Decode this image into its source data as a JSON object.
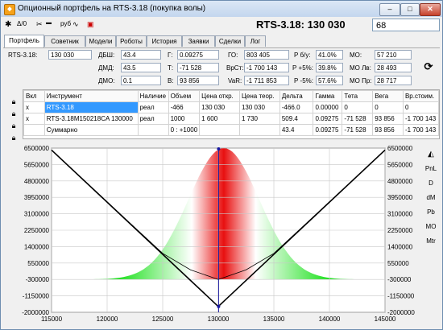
{
  "window": {
    "title": "Опционный портфель на RTS-3.18 (покупка волы)",
    "buttons": [
      "–",
      "□",
      "✕"
    ]
  },
  "toolbar": {
    "items": [
      "Δ/0",
      "руб"
    ],
    "heading": "RTS-3.18: 130 030",
    "right_value": "68"
  },
  "tabs": [
    "Портфель",
    "Советник",
    "Модели",
    "Роботы",
    "История",
    "Заявки",
    "Сделки",
    "Лог"
  ],
  "params": {
    "rts_label": "RTS-3.18:",
    "rts_value": "130 030",
    "dbsh_label": "ДБШ:",
    "dbsh_value": "43.4",
    "dmd_label": "ДМД:",
    "dmd_value": "43.5",
    "dmo_label": "ДМО:",
    "dmo_value": "0.1",
    "g_label": "Г:",
    "g_value": "0.09275",
    "t_label": "Т:",
    "t_value": "-71 528",
    "v_label": "В:",
    "v_value": "93 856",
    "go_label": "ГО:",
    "go_value": "803 405",
    "vrst_label": "ВрСт:",
    "vrst_value": "-1 700 143",
    "var_label": "VaR:",
    "var_value": "-1 711 853",
    "rbu_label": "Р б/у:",
    "rbu_value": "41.0%",
    "rp5_label": "Р +5%:",
    "rp5_value": "39.8%",
    "rm5_label": "Р -5%:",
    "rm5_value": "57.6%",
    "mo_label": "МО:",
    "mo_value": "57 210",
    "molv_label": "МО Лв:",
    "molv_value": "28 493",
    "mopr_label": "МО Пр:",
    "mopr_value": "28 717"
  },
  "table": {
    "headers": [
      "Вкл",
      "Инструмент",
      "Наличие",
      "Объем",
      "Цена откр.",
      "Цена теор.",
      "Дельта",
      "Гамма",
      "Тета",
      "Вега",
      "Вр.стоим."
    ],
    "rows": [
      [
        "x",
        "RTS-3.18",
        "реал",
        "-466",
        "130 030",
        "130 030",
        "-466.0",
        "0.00000",
        "0",
        "0",
        "0"
      ],
      [
        "x",
        "RTS-3.18M150218CA 130000",
        "реал",
        "1000",
        "1 600",
        "1 730",
        "509.4",
        "0.09275",
        "-71 528",
        "93 856",
        "-1 700 143"
      ],
      [
        "",
        "Суммарно",
        "",
        "0 : +1000",
        "",
        "",
        "43.4",
        "0.09275",
        "-71 528",
        "93 856",
        "-1 700 143"
      ]
    ]
  },
  "left_icons": [
    "lock-icon",
    "lock-icon",
    "lock-icon",
    "lock-icon"
  ],
  "side_left_tools": [
    "cursor-icon",
    "zoom-vertical-icon",
    "zoom-vertical-icon",
    "zoom-horizontal-icon",
    "zoom-horizontal-icon",
    "magnifier-icon",
    "move-icon",
    "list-icon"
  ],
  "side_left_log": "leg",
  "side_right_buttons": [
    "PnL",
    "D",
    "dM",
    "Pb",
    "MO",
    "Mtr"
  ],
  "colors": {
    "accent": "#3399ff",
    "density_red": "#e81010",
    "density_green": "#18e018",
    "grid": "#c8c8c8"
  },
  "chart_data": {
    "type": "line",
    "x_ticks": [
      "115000",
      "120000",
      "125000",
      "130000",
      "135000",
      "140000",
      "145000"
    ],
    "y_ticks": [
      "6500000",
      "5650000",
      "4800000",
      "3950000",
      "3100000",
      "2250000",
      "1400000",
      "550000",
      "-300000",
      "-1150000",
      "-2000000"
    ],
    "xlim": [
      115000,
      145000
    ],
    "ylim": [
      -2000000,
      6500000
    ],
    "current_price": 130030,
    "series": [
      {
        "values": [
          [
            115000,
            6400000
          ],
          [
            130000,
            -1700143
          ],
          [
            145000,
            6400000
          ]
        ]
      },
      {
        "values": [
          [
            115000,
            6400000
          ],
          [
            122000,
            2650000
          ],
          [
            125000,
            1050000
          ],
          [
            127500,
            200000
          ],
          [
            130000,
            -300000
          ],
          [
            132500,
            200000
          ],
          [
            135000,
            1050000
          ],
          [
            138000,
            2650000
          ],
          [
            145000,
            6400000
          ]
        ]
      }
    ],
    "distribution": {
      "center": 130500,
      "sigma": 3200,
      "peak": 6500000,
      "base": -300000
    }
  }
}
